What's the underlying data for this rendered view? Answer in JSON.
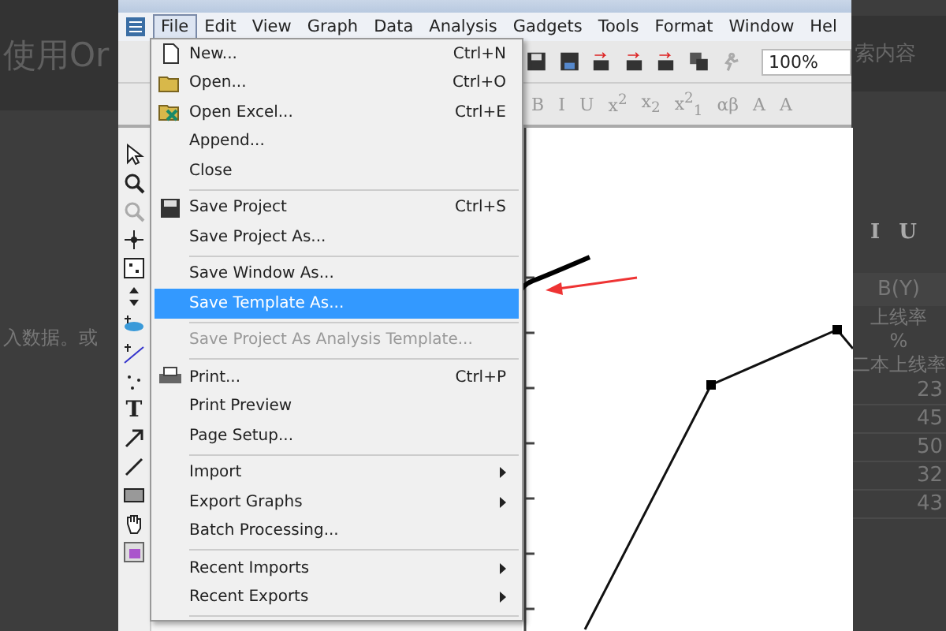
{
  "page_left": {
    "heading": "使用Or",
    "text": "入数据。或"
  },
  "menubar": [
    {
      "label": "File",
      "selected": true
    },
    {
      "label": "Edit",
      "selected": false
    },
    {
      "label": "View",
      "selected": false
    },
    {
      "label": "Graph",
      "selected": false
    },
    {
      "label": "Data",
      "selected": false
    },
    {
      "label": "Analysis",
      "selected": false
    },
    {
      "label": "Gadgets",
      "selected": false
    },
    {
      "label": "Tools",
      "selected": false
    },
    {
      "label": "Format",
      "selected": false
    },
    {
      "label": "Window",
      "selected": false
    },
    {
      "label": "Hel",
      "selected": false
    }
  ],
  "toolbar": {
    "zoom": "100%"
  },
  "format_toolbar": [
    "B",
    "I",
    "U",
    "x$^{2}$",
    "x$_{2}$",
    "x$^{2}$$_{1}$",
    "αβ",
    "A",
    "A"
  ],
  "toolbox": {
    "text_tool": "T"
  },
  "file_menu": [
    {
      "kind": "item",
      "label": "New...",
      "shortcut": "Ctrl+N",
      "selected": false,
      "disabled": false,
      "submenu": false
    },
    {
      "kind": "item",
      "label": "Open...",
      "shortcut": "Ctrl+O",
      "selected": false,
      "disabled": false,
      "submenu": false
    },
    {
      "kind": "item",
      "label": "Open Excel...",
      "shortcut": "Ctrl+E",
      "selected": false,
      "disabled": false,
      "submenu": false
    },
    {
      "kind": "item",
      "label": "Append...",
      "selected": false,
      "disabled": false,
      "submenu": false
    },
    {
      "kind": "item",
      "label": "Close",
      "selected": false,
      "disabled": false,
      "submenu": false
    },
    {
      "kind": "separator"
    },
    {
      "kind": "item",
      "label": "Save Project",
      "shortcut": "Ctrl+S",
      "selected": false,
      "disabled": false,
      "submenu": false
    },
    {
      "kind": "item",
      "label": "Save Project As...",
      "selected": false,
      "disabled": false,
      "submenu": false
    },
    {
      "kind": "separator"
    },
    {
      "kind": "item",
      "label": "Save Window As...",
      "selected": false,
      "disabled": false,
      "submenu": false
    },
    {
      "kind": "item",
      "label": "Save Template As...",
      "selected": true,
      "disabled": false,
      "submenu": false
    },
    {
      "kind": "separator"
    },
    {
      "kind": "item",
      "label": "Save Project As Analysis Template...",
      "selected": false,
      "disabled": true,
      "submenu": false
    },
    {
      "kind": "separator"
    },
    {
      "kind": "item",
      "label": "Print...",
      "shortcut": "Ctrl+P",
      "selected": false,
      "disabled": false,
      "submenu": false
    },
    {
      "kind": "item",
      "label": "Print Preview",
      "selected": false,
      "disabled": false,
      "submenu": false
    },
    {
      "kind": "item",
      "label": "Page Setup...",
      "selected": false,
      "disabled": false,
      "submenu": false
    },
    {
      "kind": "separator"
    },
    {
      "kind": "item",
      "label": "Import",
      "selected": false,
      "disabled": false,
      "submenu": true
    },
    {
      "kind": "item",
      "label": "Export Graphs",
      "selected": false,
      "disabled": false,
      "submenu": true
    },
    {
      "kind": "item",
      "label": "Batch Processing...",
      "selected": false,
      "disabled": false,
      "submenu": false
    },
    {
      "kind": "separator"
    },
    {
      "kind": "item",
      "label": "Recent Imports",
      "selected": false,
      "disabled": false,
      "submenu": true
    },
    {
      "kind": "item",
      "label": "Recent Exports",
      "selected": false,
      "disabled": false,
      "submenu": true
    },
    {
      "kind": "separator"
    }
  ],
  "page_right": {
    "search_hint": "索内容",
    "toolbar": [
      "I",
      "U"
    ],
    "column_header": "B(Y)",
    "long_name": "上线率",
    "units": "%",
    "comment": "二本上线率",
    "values": [
      "23",
      "45",
      "50",
      "32",
      "43"
    ]
  }
}
